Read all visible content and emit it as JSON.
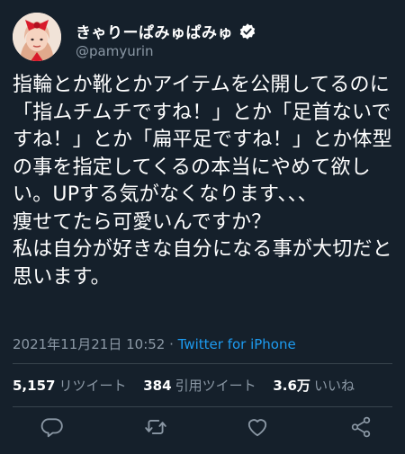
{
  "user": {
    "name": "きゃりーぱみゅぱみゅ",
    "handle": "@pamyurin"
  },
  "tweet": {
    "text": "指輪とか靴とかアイテムを公開してるのに「指ムチムチですね！」とか「足首ないですね！」とか「扁平足ですね！」とか体型の事を指定してくるの本当にやめて欲しい。UPする気がなくなります、、、\n痩せてたら可愛いんですか？\n私は自分が好きな自分になる事が大切だと思います。",
    "timestamp": "2021年11月21日 10:52",
    "separator": " · ",
    "app": "Twitter for iPhone"
  },
  "stats": {
    "retweets_count": "5,157",
    "retweets_label": "リツイート",
    "quotes_count": "384",
    "quotes_label": "引用ツイート",
    "likes_count": "3.6万",
    "likes_label": "いいね"
  },
  "icons": {
    "verified": "verified-badge-icon",
    "reply": "reply-icon",
    "retweet": "retweet-icon",
    "like": "heart-icon",
    "share": "share-icon"
  },
  "colors": {
    "background": "#15202b",
    "accent": "#1d9bf0",
    "secondary_text": "#8b98a5"
  }
}
